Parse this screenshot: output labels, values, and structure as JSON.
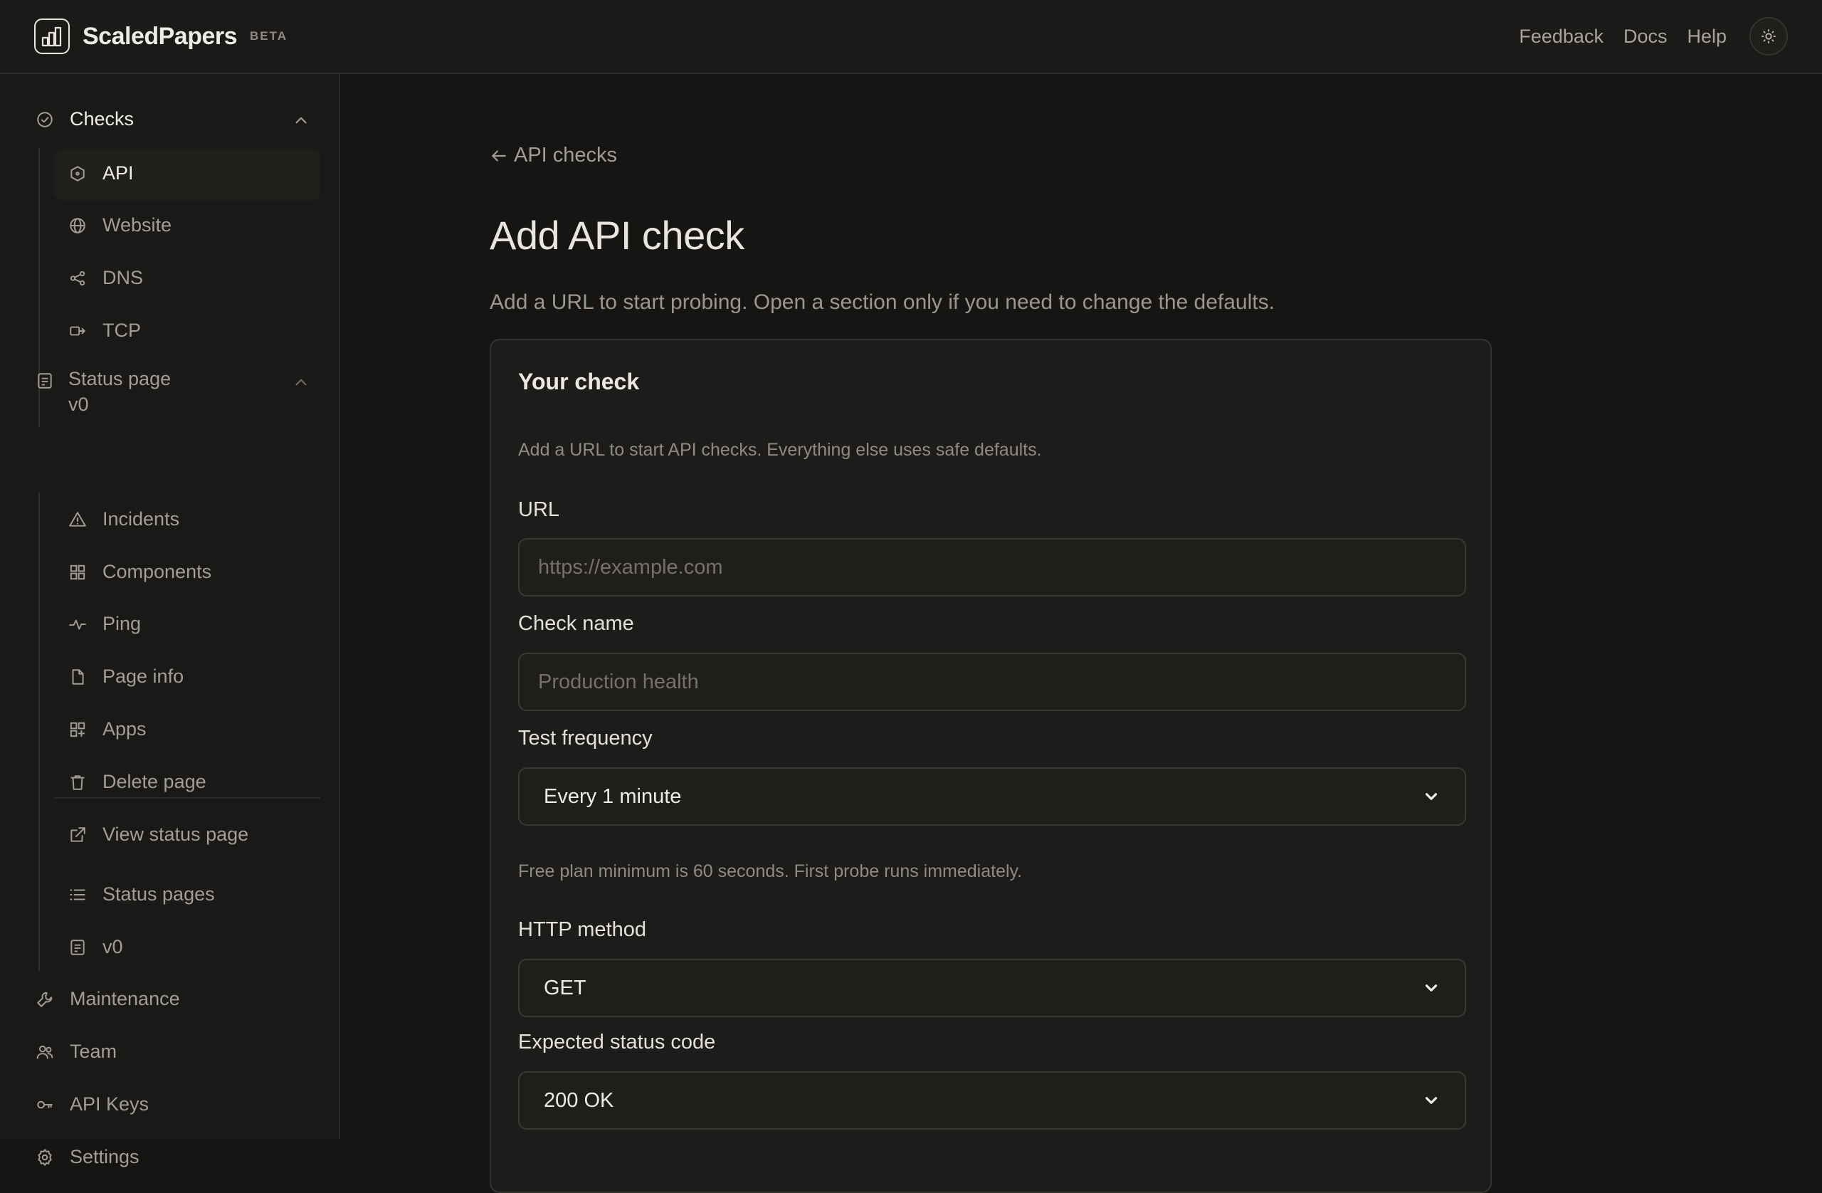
{
  "header": {
    "brand": "ScaledPapers",
    "badge": "BETA",
    "links": [
      "Feedback",
      "Docs",
      "Help"
    ],
    "theme_icon": "sun-icon"
  },
  "sidebar": {
    "checks_label": "Checks",
    "checks_items": [
      "API",
      "Website",
      "DNS",
      "TCP"
    ],
    "status_page_label": "Status page",
    "status_page_version": "v0",
    "status_items": [
      "Incidents",
      "Components",
      "Ping",
      "Page info",
      "Apps",
      "Delete page",
      "View status page"
    ],
    "status_pages_label": "Status pages",
    "status_pages_v0": "v0",
    "bottom_items": [
      "Maintenance",
      "Team",
      "API Keys",
      "Settings"
    ]
  },
  "main": {
    "back_link": "API checks",
    "title": "Add API check",
    "subtitle": "Add a URL to start probing. Open a section only if you need to change the defaults.",
    "card": {
      "title": "Your check",
      "intro": "Add a URL to start API checks. Everything else uses safe defaults.",
      "url_label": "URL",
      "url_placeholder": "https://example.com",
      "name_label": "Check name",
      "name_placeholder": "Production health",
      "frequency_label": "Test frequency",
      "frequency_value": "Every 1 minute",
      "frequency_help": "Free plan minimum is 60 seconds. First probe runs immediately.",
      "method_label": "HTTP method",
      "method_value": "GET",
      "status_label": "Expected status code",
      "status_value": "200 OK"
    }
  }
}
